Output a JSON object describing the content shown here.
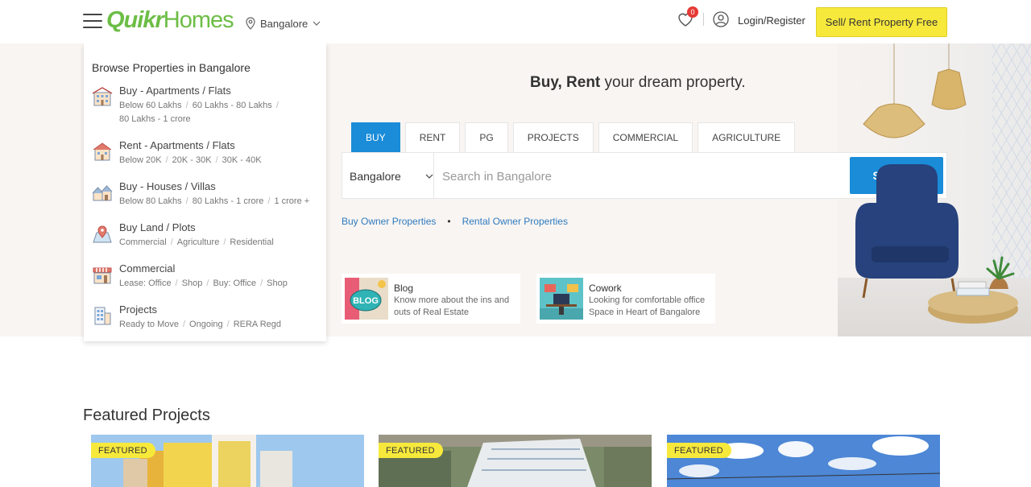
{
  "header": {
    "logo_part1": "Quikr",
    "logo_part2": "Homes",
    "city": "Bangalore",
    "favourites_count": "0",
    "login_label": "Login/Register",
    "sell_button": "Sell/ Rent Property Free"
  },
  "sidebar": {
    "title": "Browse Properties in Bangalore",
    "items": [
      {
        "label": "Buy - Apartments / Flats",
        "links": [
          "Below 60 Lakhs",
          "60 Lakhs - 80 Lakhs",
          "80 Lakhs - 1 crore"
        ],
        "icon": "apartment-icon"
      },
      {
        "label": "Rent - Apartments / Flats",
        "links": [
          "Below 20K",
          "20K - 30K",
          "30K - 40K"
        ],
        "icon": "rent-house-icon"
      },
      {
        "label": "Buy - Houses / Villas",
        "links": [
          "Below 80 Lakhs",
          "80 Lakhs - 1 crore",
          "1 crore +"
        ],
        "icon": "villa-icon"
      },
      {
        "label": "Buy Land / Plots",
        "links": [
          "Commercial",
          "Agriculture",
          "Residential"
        ],
        "icon": "land-plot-icon"
      },
      {
        "label": "Commercial",
        "links": [
          "Lease: Office",
          "Shop",
          "Buy: Office",
          "Shop"
        ],
        "icon": "shop-icon"
      },
      {
        "label": "Projects",
        "links": [
          "Ready to Move",
          "Ongoing",
          "RERA Regd"
        ],
        "icon": "building-icon"
      }
    ]
  },
  "hero": {
    "tagline_bold": "Buy, Rent",
    "tagline_rest": " your dream property.",
    "tabs": [
      "BUY",
      "RENT",
      "PG",
      "PROJECTS",
      "COMMERCIAL",
      "AGRICULTURE"
    ],
    "active_tab": "BUY",
    "search_city": "Bangalore",
    "search_placeholder": "Search in Bangalore",
    "search_button": "SEARCH",
    "owner_links": [
      "Buy Owner Properties",
      "Rental Owner Properties"
    ]
  },
  "cards": [
    {
      "title": "Blog",
      "desc": "Know more about the ins and outs of Real Estate",
      "thumb_text": "BLOG"
    },
    {
      "title": "Cowork",
      "desc": "Looking for comfortable office Space in Heart of Bangalore"
    }
  ],
  "featured": {
    "heading": "Featured Projects",
    "badge": "FEATURED"
  },
  "colors": {
    "brand_green": "#6cbd45",
    "accent_blue": "#1a8cd8",
    "sell_yellow": "#f7e93c"
  }
}
